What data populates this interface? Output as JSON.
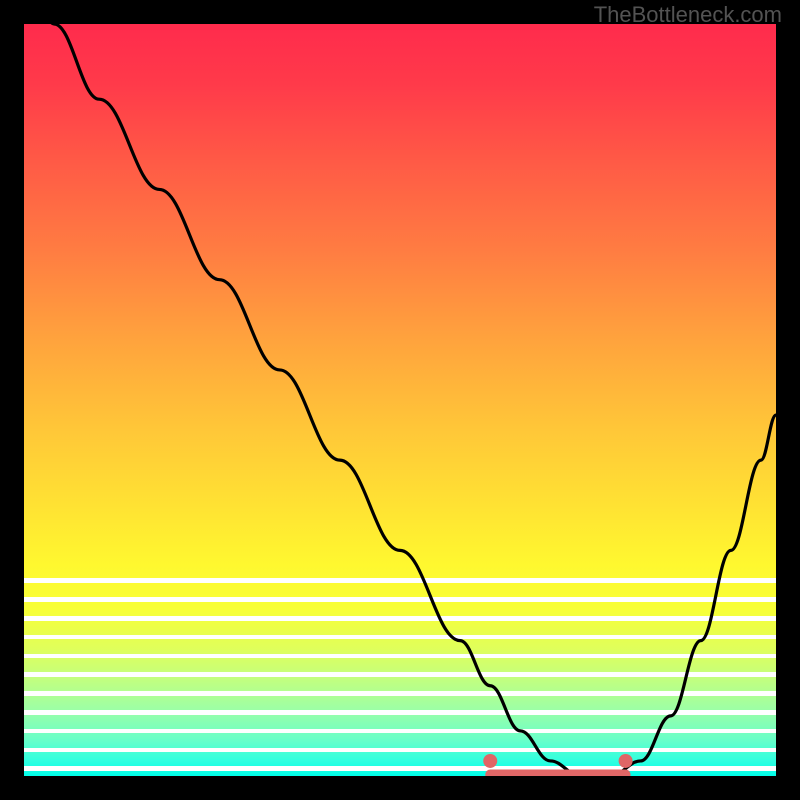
{
  "watermark": "TheBottleneck.com",
  "colors": {
    "curve_stroke": "#000000",
    "marker_fill": "#e06666",
    "band_color": "#ffffff",
    "frame_bg": "#000000"
  },
  "chart_data": {
    "type": "line",
    "title": "",
    "xlabel": "",
    "ylabel": "",
    "xlim": [
      0,
      100
    ],
    "ylim": [
      0,
      100
    ],
    "gradient_axis": "y",
    "series": [
      {
        "name": "bottleneck-curve",
        "x": [
          0,
          4,
          10,
          18,
          26,
          34,
          42,
          50,
          58,
          62,
          66,
          70,
          74,
          78,
          82,
          86,
          90,
          94,
          98,
          100
        ],
        "y": [
          110,
          100,
          90,
          78,
          66,
          54,
          42,
          30,
          18,
          12,
          6,
          2,
          0,
          0,
          2,
          8,
          18,
          30,
          42,
          48
        ]
      }
    ],
    "flat_region": {
      "x_start": 62,
      "x_end": 80,
      "y": 0.2
    },
    "markers": [
      {
        "name": "flat-start",
        "x": 62,
        "y": 2
      },
      {
        "name": "flat-end",
        "x": 80,
        "y": 2
      }
    ],
    "bands_y": [
      74,
      76.5,
      79,
      81.5,
      84,
      86.5,
      89,
      91.5,
      94,
      96.5,
      99
    ]
  }
}
